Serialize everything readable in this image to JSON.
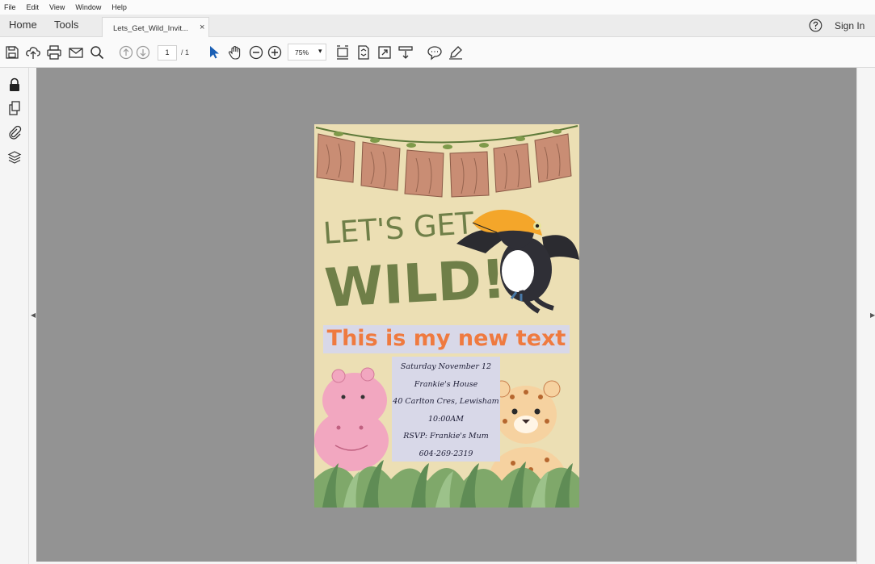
{
  "menubar": {
    "items": [
      "File",
      "Edit",
      "View",
      "Window",
      "Help"
    ]
  },
  "tabbar": {
    "home": "Home",
    "tools": "Tools",
    "document_tab": "Lets_Get_Wild_Invit...",
    "close_glyph": "×",
    "sign_in": "Sign In"
  },
  "toolbar": {
    "page_current": "1",
    "page_total": "/ 1",
    "zoom": "75%",
    "zoom_caret": "▾",
    "icons": [
      "save-icon",
      "upload-icon",
      "print-icon",
      "email-icon",
      "search-icon",
      "prev-page-icon",
      "next-page-icon",
      "select-arrow-icon",
      "hand-icon",
      "zoom-out-icon",
      "zoom-in-icon",
      "scroll-mode-icon",
      "fit-page-icon",
      "full-screen-icon",
      "read-mode-icon",
      "comment-icon",
      "sign-icon"
    ]
  },
  "leftrail": {
    "icons": [
      "lock-icon",
      "pages-icon",
      "attachment-icon",
      "layers-icon"
    ]
  },
  "document": {
    "title_line1": "LET'S GET",
    "title_line2": "WILD!",
    "headline": "This is my new text",
    "details": [
      "Saturday November 12",
      "Frankie's House",
      "40 Carlton Cres, Lewisham",
      "10:00AM",
      "RSVP: Frankie's Mum",
      "604-269-2319"
    ]
  },
  "colors": {
    "page_bg": "#ecdfb4",
    "headline": "#ef7a3f",
    "text_box": "#d8d8e8",
    "canvas": "#939393",
    "title_green": "#6f7f48"
  }
}
